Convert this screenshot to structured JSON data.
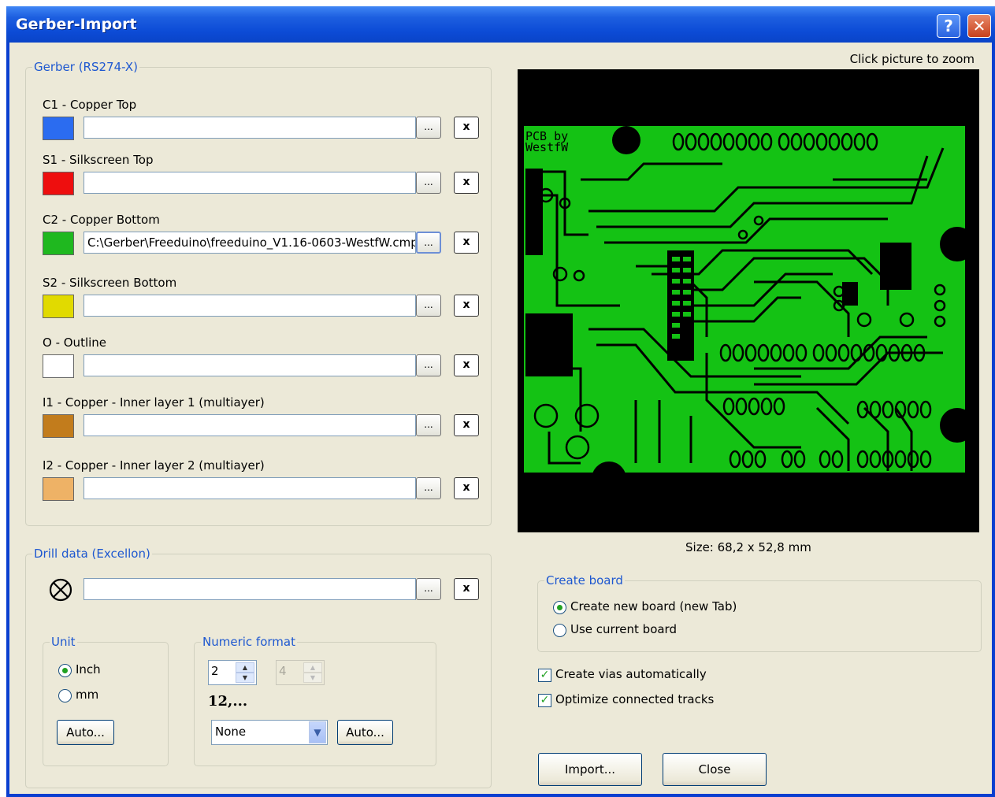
{
  "window": {
    "title": "Gerber-Import",
    "help_label": "?",
    "close_label": "✕"
  },
  "gerber": {
    "legend": "Gerber (RS274-X)",
    "browse_label": "...",
    "clear_label": "x",
    "layers": [
      {
        "label": "C1 - Copper Top",
        "color": "#2b6cf0",
        "path": ""
      },
      {
        "label": "S1 - Silkscreen Top",
        "color": "#ee0e0e",
        "path": ""
      },
      {
        "label": "C2 - Copper Bottom",
        "color": "#1fb81f",
        "path": "C:\\Gerber\\Freeduino\\freeduino_V1.16-0603-WestfW.cmp"
      },
      {
        "label": "S2 - Silkscreen Bottom",
        "color": "#e1da00",
        "path": ""
      },
      {
        "label": "O - Outline",
        "color": "#ffffff",
        "path": ""
      },
      {
        "label": "I1 - Copper - Inner layer 1 (multiayer)",
        "color": "#c27c1c",
        "path": ""
      },
      {
        "label": "I2 - Copper - Inner layer 2 (multiayer)",
        "color": "#eeb266",
        "path": ""
      }
    ]
  },
  "preview": {
    "zoom_hint": "Click picture to zoom",
    "size_text": "Size: 68,2 x 52,8 mm",
    "pcb_text_1": "PCB by",
    "pcb_text_2": "WestfW",
    "copper_color": "#14c214"
  },
  "drill": {
    "legend": "Drill data (Excellon)",
    "path": "",
    "unit": {
      "legend": "Unit",
      "options": [
        "Inch",
        "mm"
      ],
      "selected": "Inch",
      "auto_label": "Auto..."
    },
    "numeric": {
      "legend": "Numeric format",
      "int_digits": "2",
      "dec_digits": "4",
      "example": "12,...",
      "zero_mode": "None",
      "auto_label": "Auto..."
    }
  },
  "create_board": {
    "legend": "Create board",
    "options": [
      "Create new board (new Tab)",
      "Use current board"
    ],
    "selected": "Create new board (new Tab)"
  },
  "options": {
    "create_vias": "Create vias automatically",
    "optimize_tracks": "Optimize connected tracks",
    "create_vias_checked": true,
    "optimize_tracks_checked": true
  },
  "buttons": {
    "import": "Import...",
    "close": "Close"
  }
}
